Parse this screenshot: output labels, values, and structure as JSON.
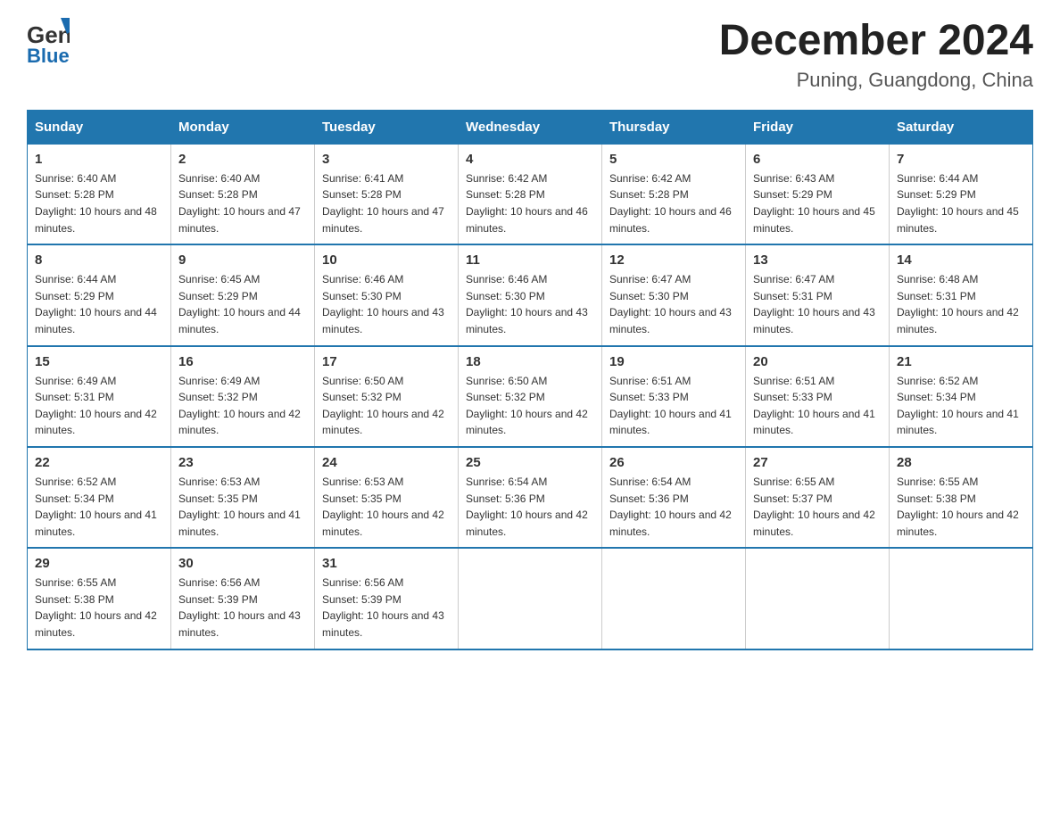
{
  "logo": {
    "general": "General",
    "blue": "Blue"
  },
  "title": "December 2024",
  "location": "Puning, Guangdong, China",
  "weekdays": [
    "Sunday",
    "Monday",
    "Tuesday",
    "Wednesday",
    "Thursday",
    "Friday",
    "Saturday"
  ],
  "weeks": [
    [
      {
        "day": "1",
        "sunrise": "6:40 AM",
        "sunset": "5:28 PM",
        "daylight": "10 hours and 48 minutes."
      },
      {
        "day": "2",
        "sunrise": "6:40 AM",
        "sunset": "5:28 PM",
        "daylight": "10 hours and 47 minutes."
      },
      {
        "day": "3",
        "sunrise": "6:41 AM",
        "sunset": "5:28 PM",
        "daylight": "10 hours and 47 minutes."
      },
      {
        "day": "4",
        "sunrise": "6:42 AM",
        "sunset": "5:28 PM",
        "daylight": "10 hours and 46 minutes."
      },
      {
        "day": "5",
        "sunrise": "6:42 AM",
        "sunset": "5:28 PM",
        "daylight": "10 hours and 46 minutes."
      },
      {
        "day": "6",
        "sunrise": "6:43 AM",
        "sunset": "5:29 PM",
        "daylight": "10 hours and 45 minutes."
      },
      {
        "day": "7",
        "sunrise": "6:44 AM",
        "sunset": "5:29 PM",
        "daylight": "10 hours and 45 minutes."
      }
    ],
    [
      {
        "day": "8",
        "sunrise": "6:44 AM",
        "sunset": "5:29 PM",
        "daylight": "10 hours and 44 minutes."
      },
      {
        "day": "9",
        "sunrise": "6:45 AM",
        "sunset": "5:29 PM",
        "daylight": "10 hours and 44 minutes."
      },
      {
        "day": "10",
        "sunrise": "6:46 AM",
        "sunset": "5:30 PM",
        "daylight": "10 hours and 43 minutes."
      },
      {
        "day": "11",
        "sunrise": "6:46 AM",
        "sunset": "5:30 PM",
        "daylight": "10 hours and 43 minutes."
      },
      {
        "day": "12",
        "sunrise": "6:47 AM",
        "sunset": "5:30 PM",
        "daylight": "10 hours and 43 minutes."
      },
      {
        "day": "13",
        "sunrise": "6:47 AM",
        "sunset": "5:31 PM",
        "daylight": "10 hours and 43 minutes."
      },
      {
        "day": "14",
        "sunrise": "6:48 AM",
        "sunset": "5:31 PM",
        "daylight": "10 hours and 42 minutes."
      }
    ],
    [
      {
        "day": "15",
        "sunrise": "6:49 AM",
        "sunset": "5:31 PM",
        "daylight": "10 hours and 42 minutes."
      },
      {
        "day": "16",
        "sunrise": "6:49 AM",
        "sunset": "5:32 PM",
        "daylight": "10 hours and 42 minutes."
      },
      {
        "day": "17",
        "sunrise": "6:50 AM",
        "sunset": "5:32 PM",
        "daylight": "10 hours and 42 minutes."
      },
      {
        "day": "18",
        "sunrise": "6:50 AM",
        "sunset": "5:32 PM",
        "daylight": "10 hours and 42 minutes."
      },
      {
        "day": "19",
        "sunrise": "6:51 AM",
        "sunset": "5:33 PM",
        "daylight": "10 hours and 41 minutes."
      },
      {
        "day": "20",
        "sunrise": "6:51 AM",
        "sunset": "5:33 PM",
        "daylight": "10 hours and 41 minutes."
      },
      {
        "day": "21",
        "sunrise": "6:52 AM",
        "sunset": "5:34 PM",
        "daylight": "10 hours and 41 minutes."
      }
    ],
    [
      {
        "day": "22",
        "sunrise": "6:52 AM",
        "sunset": "5:34 PM",
        "daylight": "10 hours and 41 minutes."
      },
      {
        "day": "23",
        "sunrise": "6:53 AM",
        "sunset": "5:35 PM",
        "daylight": "10 hours and 41 minutes."
      },
      {
        "day": "24",
        "sunrise": "6:53 AM",
        "sunset": "5:35 PM",
        "daylight": "10 hours and 42 minutes."
      },
      {
        "day": "25",
        "sunrise": "6:54 AM",
        "sunset": "5:36 PM",
        "daylight": "10 hours and 42 minutes."
      },
      {
        "day": "26",
        "sunrise": "6:54 AM",
        "sunset": "5:36 PM",
        "daylight": "10 hours and 42 minutes."
      },
      {
        "day": "27",
        "sunrise": "6:55 AM",
        "sunset": "5:37 PM",
        "daylight": "10 hours and 42 minutes."
      },
      {
        "day": "28",
        "sunrise": "6:55 AM",
        "sunset": "5:38 PM",
        "daylight": "10 hours and 42 minutes."
      }
    ],
    [
      {
        "day": "29",
        "sunrise": "6:55 AM",
        "sunset": "5:38 PM",
        "daylight": "10 hours and 42 minutes."
      },
      {
        "day": "30",
        "sunrise": "6:56 AM",
        "sunset": "5:39 PM",
        "daylight": "10 hours and 43 minutes."
      },
      {
        "day": "31",
        "sunrise": "6:56 AM",
        "sunset": "5:39 PM",
        "daylight": "10 hours and 43 minutes."
      },
      null,
      null,
      null,
      null
    ]
  ]
}
